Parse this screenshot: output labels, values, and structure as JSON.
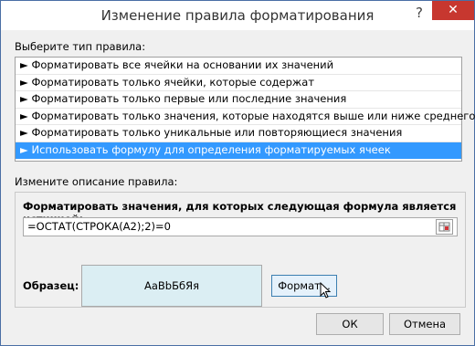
{
  "window": {
    "title": "Изменение правила форматирования",
    "help_glyph": "?",
    "close_glyph": "✕"
  },
  "rule_type": {
    "label": "Выберите тип правила:",
    "items": [
      "► Форматировать все ячейки на основании их значений",
      "► Форматировать только ячейки, которые содержат",
      "► Форматировать только первые или последние значения",
      "► Форматировать только значения, которые находятся выше или ниже среднего",
      "► Форматировать только уникальные или повторяющиеся значения",
      "► Использовать формулу для определения форматируемых ячеек"
    ],
    "selected_index": 5
  },
  "description": {
    "label": "Измените описание правила:",
    "formula_label": "Форматировать значения, для которых следующая формула является истинной:",
    "formula_value": "=ОСТАТ(СТРОКА(A2);2)=0",
    "sample_label": "Образец:",
    "sample_text": "АаВbБбЯя",
    "format_button": "Формат..."
  },
  "buttons": {
    "ok": "ОК",
    "cancel": "Отмена"
  },
  "colors": {
    "close_red": "#c7372f",
    "selection_blue": "#3399ff",
    "sample_fill": "#dbeef3"
  }
}
